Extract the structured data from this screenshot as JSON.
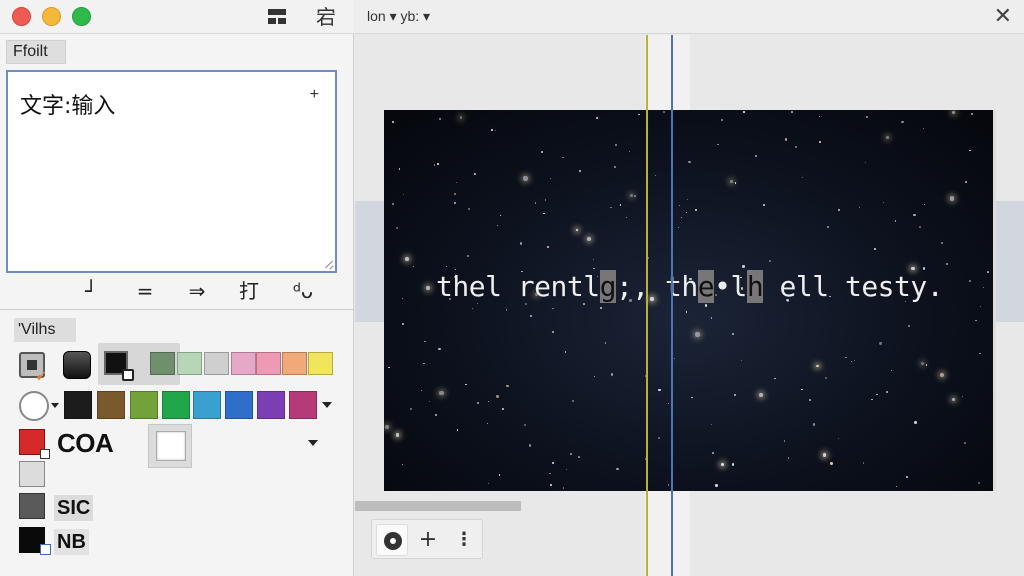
{
  "left_panel": {
    "tab_label": "Ffoilt",
    "text_box": {
      "content": "文字:输入",
      "add_mark": "+"
    },
    "format_buttons": [
      "┘",
      "=",
      "⇒",
      "打",
      "ᵈᴗ"
    ],
    "section_label": "'Vilhs",
    "tools": {
      "fill_icon": "paint-bucket-icon",
      "shape_icon": "rounded-square-icon",
      "layer_icon": "layer-duplicate-icon"
    },
    "palette_row1": [
      "#6f8f6d",
      "#b7d6b8",
      "#cfcfcf",
      "#e6a8c6",
      "#ee9ab4",
      "#f2a97a",
      "#f1e55c"
    ],
    "palette_row2": [
      "#1c1c1c",
      "#7a5a2c",
      "#74a23a",
      "#22a64a",
      "#3aa0d0",
      "#2d6fc9",
      "#7b3fb3",
      "#b43a78"
    ],
    "coa_label": "COA",
    "coa_color": "#d42a2a",
    "sic_label": "SIC",
    "sic_color": "#5a5a5a",
    "nb_label": "NB",
    "nb_color": "#0a0a0a"
  },
  "canvas": {
    "menu_label": "lon ▾ yb: ▾",
    "close_label": "✕",
    "overlay_text": {
      "seg1": "thel rentl",
      "hl1": "g",
      "seg2": ";, th",
      "hl2": "e",
      "seg3": "•l",
      "hl3": "h",
      "seg4": " ell testy."
    },
    "toolbar": {
      "settings_icon": "gear-icon",
      "add_label": "+",
      "more_label": "⋮"
    }
  }
}
